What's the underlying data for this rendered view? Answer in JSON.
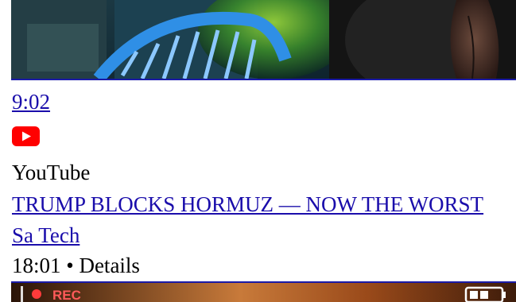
{
  "results": [
    {
      "duration": "9:02",
      "icon": "youtube-icon",
      "source": "YouTube",
      "title": "TRUMP BLOCKS HORMUZ — NOW THE WORST",
      "channel": "Sa Tech",
      "meta": "18:01 • Details"
    }
  ],
  "next_thumbnail": {
    "rec_label": "REC"
  },
  "colors": {
    "link": "#1a0dab",
    "youtube_red": "#ff0000",
    "border": "#1a1aa6"
  }
}
